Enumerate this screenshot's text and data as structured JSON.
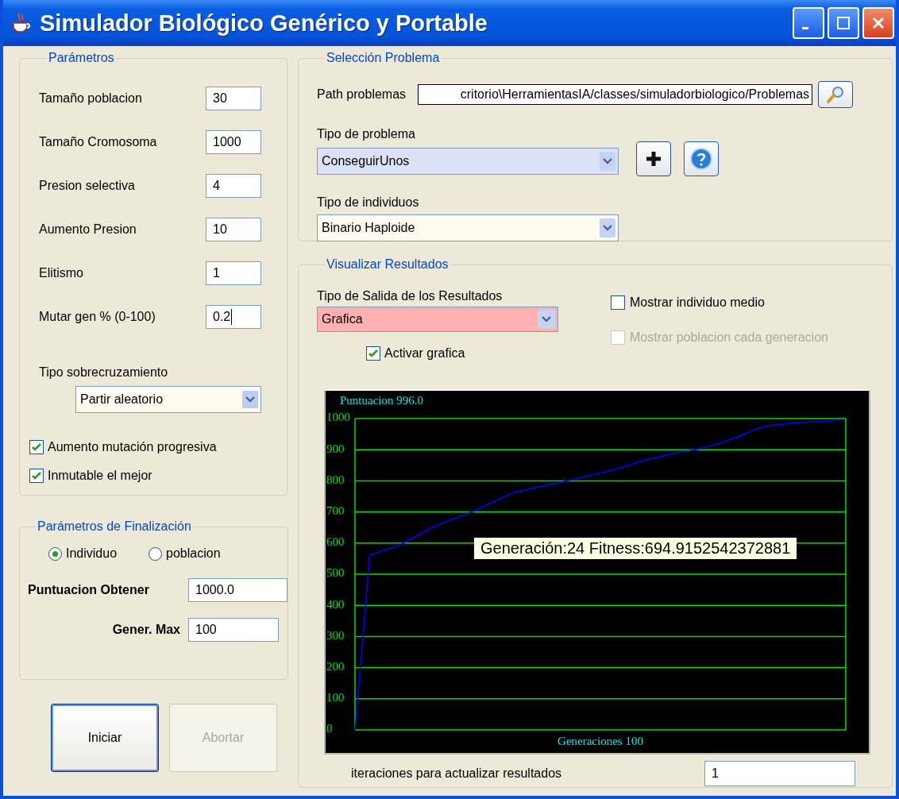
{
  "window": {
    "title": "Simulador Biológico Genérico y Portable"
  },
  "parametros": {
    "title": "Parámetros",
    "fields": [
      {
        "label": "Tamaño poblacion",
        "value": "30",
        "focused": false
      },
      {
        "label": "Tamaño Cromosoma",
        "value": "1000",
        "focused": false
      },
      {
        "label": "Presion selectiva",
        "value": "4",
        "focused": false
      },
      {
        "label": "Aumento Presion",
        "value": "10",
        "focused": false
      },
      {
        "label": "Elitismo",
        "value": "1",
        "focused": false
      },
      {
        "label": "Mutar gen % (0-100)",
        "value": "0.2",
        "focused": true
      }
    ],
    "crossover": {
      "label": "Tipo sobrecruzamiento",
      "value": "Partir aleatorio"
    },
    "checkboxes": [
      {
        "label": "Aumento mutación progresiva",
        "checked": true
      },
      {
        "label": "Inmutable el mejor",
        "checked": true
      }
    ]
  },
  "finalizacion": {
    "title": "Parámetros de Finalización",
    "options": [
      {
        "label": "Individuo",
        "selected": true
      },
      {
        "label": "poblacion",
        "selected": false
      }
    ],
    "fields": [
      {
        "label": "Puntuacion Obtener",
        "value": "1000.0"
      },
      {
        "label": "Gener. Max",
        "value": "100"
      }
    ]
  },
  "buttons": [
    {
      "label": "Iniciar",
      "disabled": false
    },
    {
      "label": "Abortar",
      "disabled": true
    }
  ],
  "seleccion": {
    "title": "Selección Problema",
    "path": {
      "label": "Path problemas",
      "value": "critorio\\HerramientasIA/classes/simuladorbiologico/Problemas"
    },
    "problem_type": {
      "label": "Tipo de problema",
      "value": "ConseguirUnos"
    },
    "individual_type": {
      "label": "Tipo de individuos",
      "value": "Binario Haploide"
    }
  },
  "visualizar": {
    "title": "Visualizar Resultados",
    "output": {
      "label": "Tipo de Salida de los Resultados",
      "value": "Grafica"
    },
    "checkboxes": [
      {
        "label": "Activar grafica",
        "checked": true,
        "disabled": false
      },
      {
        "label": "Mostrar individuo medio",
        "checked": false,
        "disabled": false
      },
      {
        "label": "Mostrar poblacion cada generacion",
        "checked": false,
        "disabled": true
      }
    ],
    "chart_data": {
      "type": "line",
      "title": "Puntuacion 996.0",
      "xlabel": "Generaciones 100",
      "grid": true,
      "ylim": [
        0,
        1000
      ],
      "yticks": [
        0,
        100,
        200,
        300,
        400,
        500,
        600,
        700,
        800,
        900,
        1000
      ],
      "categories": [
        null,
        null,
        null,
        null,
        null,
        null,
        null,
        null,
        null,
        null,
        null,
        null,
        null,
        null,
        null,
        null,
        null,
        null,
        null,
        null,
        null,
        null,
        null,
        null,
        null,
        null,
        null,
        null,
        null,
        null,
        null,
        null,
        null,
        null
      ],
      "series": [
        {
          "color": "#0000ff",
          "values": [
            0,
            561,
            578,
            594,
            618,
            645,
            666,
            684,
            702,
            724,
            746,
            765,
            776,
            786,
            796,
            807,
            818,
            829,
            842,
            857,
            870,
            881,
            891,
            899,
            911,
            925,
            941,
            962,
            977,
            982,
            987,
            989,
            991,
            996
          ]
        }
      ],
      "annotations": [
        {
          "text": "Generación:24 Fitness:694.9152542372881"
        }
      ]
    },
    "iterations": {
      "label": "iteraciones para actualizar resultados",
      "value": "1"
    }
  }
}
